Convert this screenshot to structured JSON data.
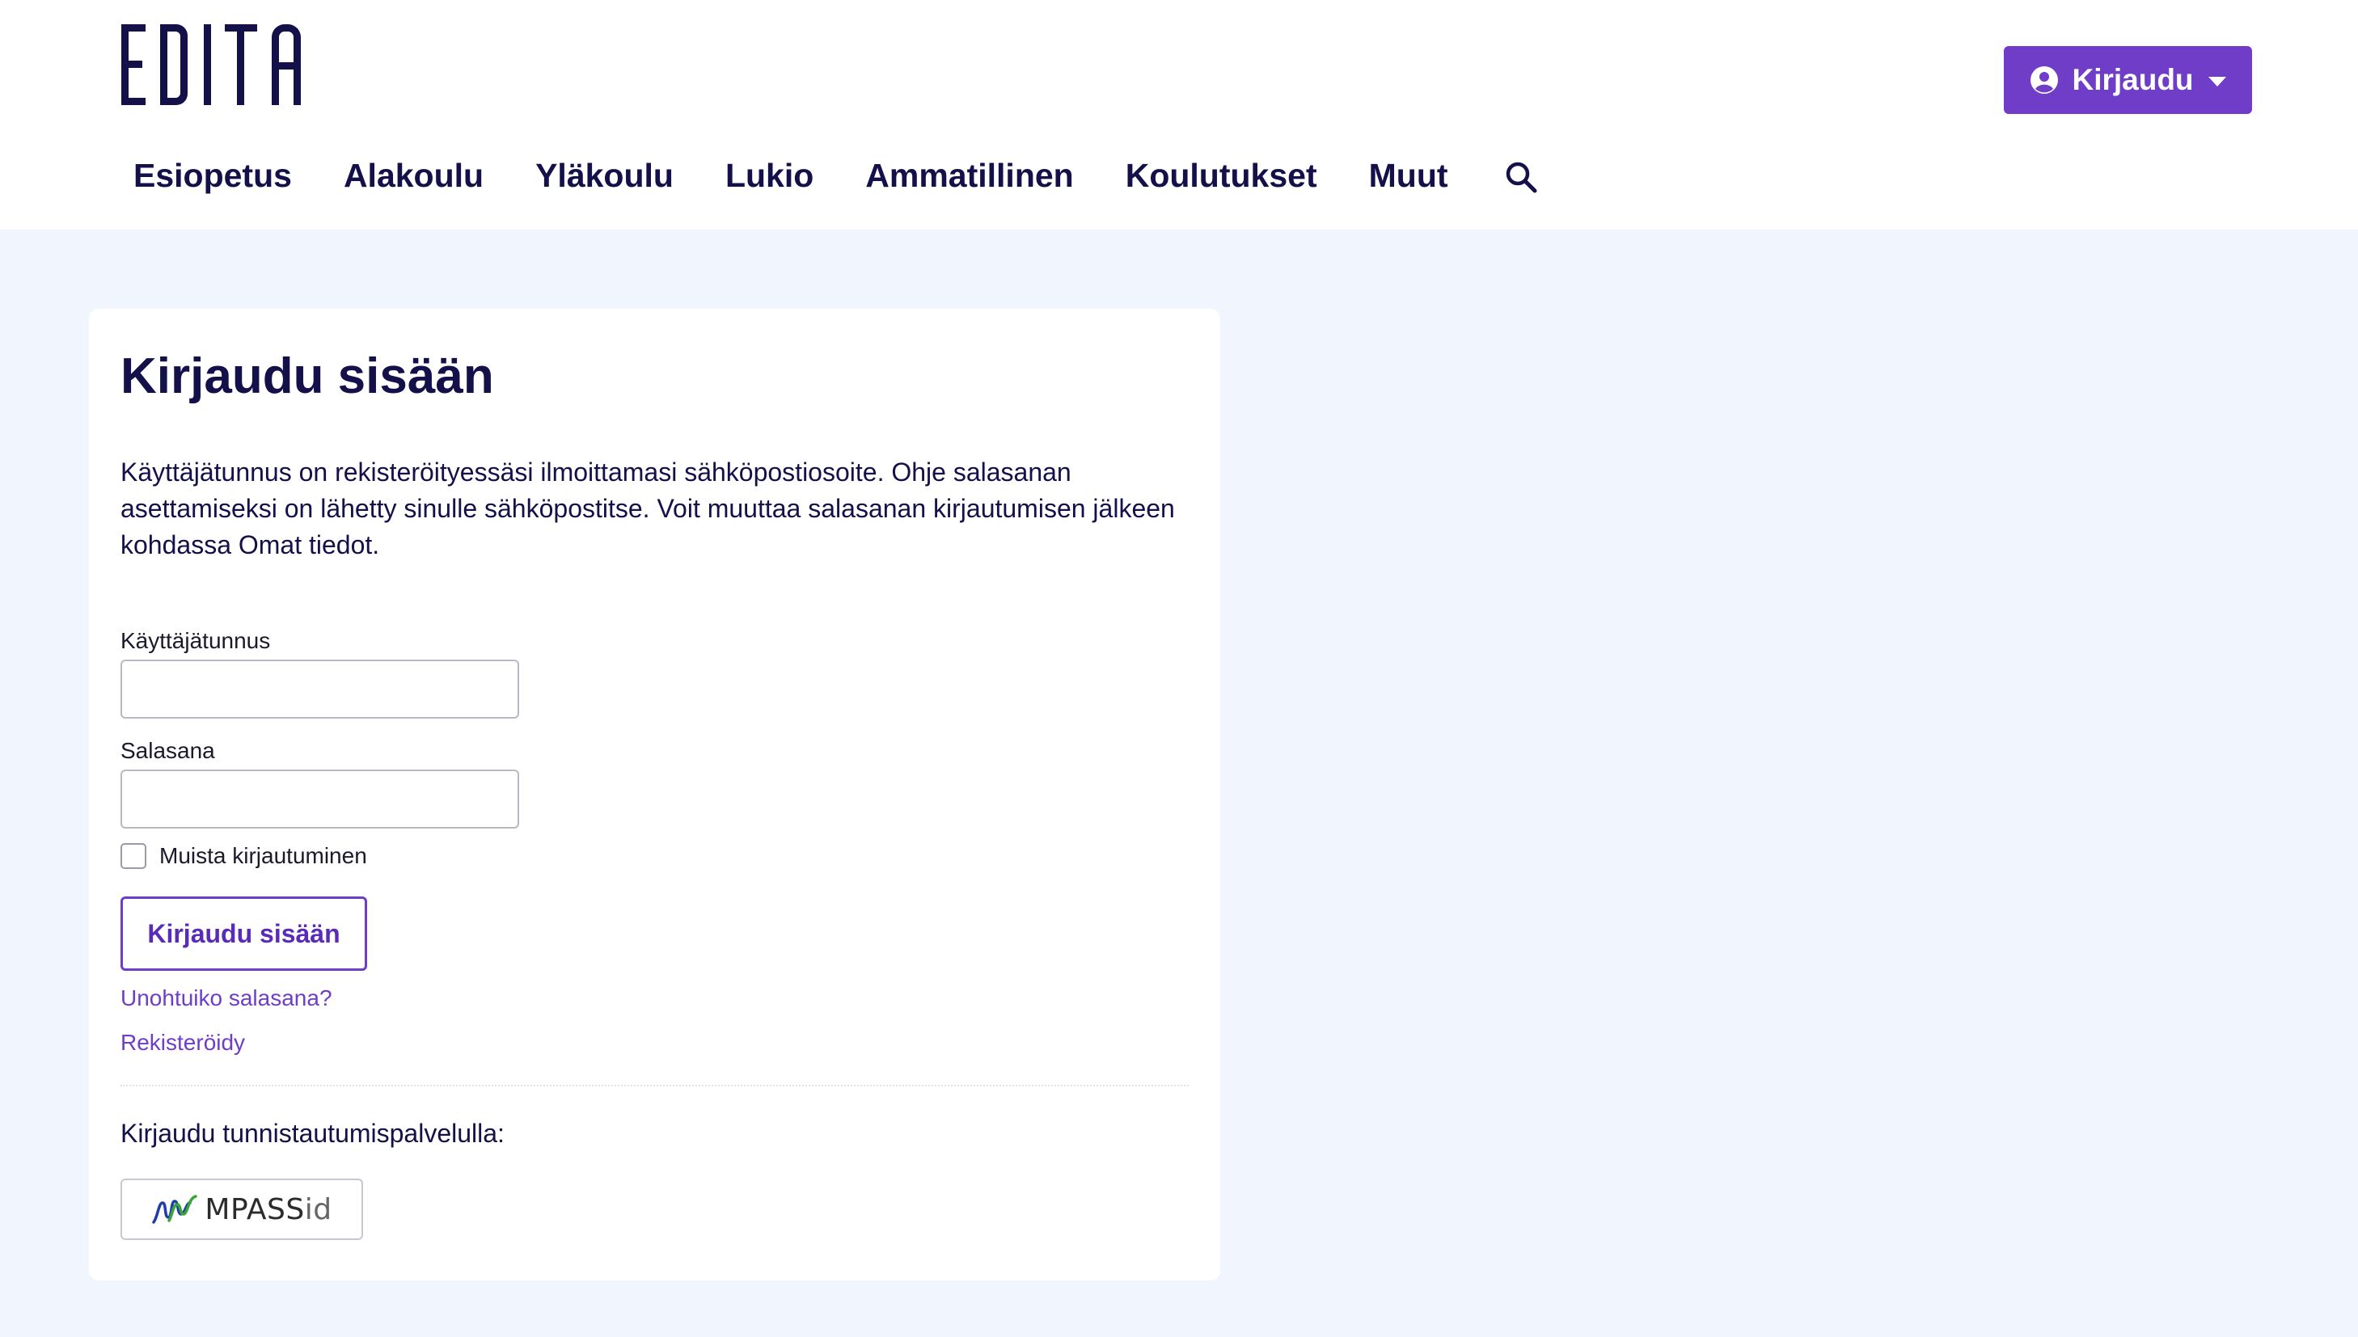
{
  "header": {
    "logo_text": "EDITA",
    "login_button_label": "Kirjaudu",
    "nav": [
      "Esiopetus",
      "Alakoulu",
      "Yläkoulu",
      "Lukio",
      "Ammatillinen",
      "Koulutukset",
      "Muut"
    ]
  },
  "login": {
    "title": "Kirjaudu sisään",
    "intro": "Käyttäjätunnus on rekisteröityessäsi ilmoittamasi sähköpostiosoite. Ohje salasanan asettamiseksi on lähetty sinulle sähköpostitse. Voit muuttaa salasanan kirjautumisen jälkeen kohdassa Omat tiedot.",
    "username_label": "Käyttäjätunnus",
    "username_value": "",
    "password_label": "Salasana",
    "password_value": "",
    "remember_label": "Muista kirjautuminen",
    "remember_checked": false,
    "submit_label": "Kirjaudu sisään",
    "forgot_link": "Unohtuiko salasana?",
    "register_link": "Rekisteröidy",
    "alt_login_label": "Kirjaudu tunnistautumispalvelulla:",
    "mpass_label_main": "MPASS",
    "mpass_label_suffix": "id"
  },
  "colors": {
    "accent": "#6f3dc8",
    "text": "#13104a",
    "page_bg": "#f1f5fd"
  }
}
